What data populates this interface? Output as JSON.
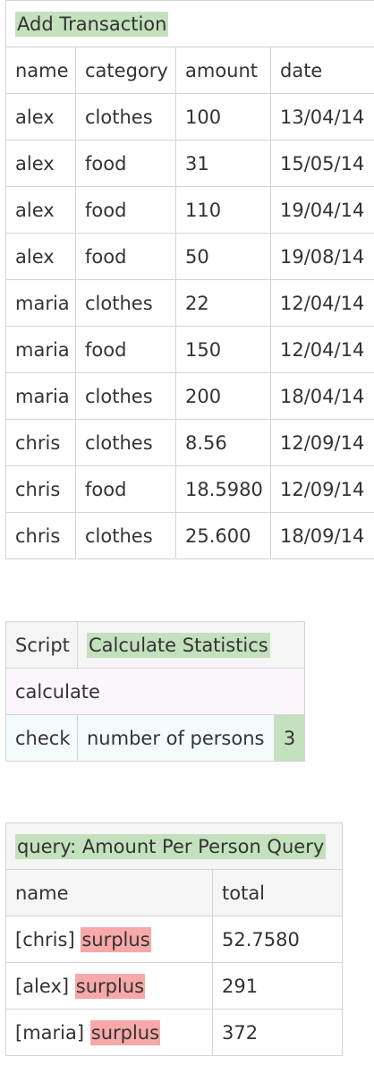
{
  "transactions": {
    "title": "Add Transaction",
    "columns": [
      "name",
      "category",
      "amount",
      "date"
    ],
    "rows": [
      [
        "alex",
        "clothes",
        "100",
        "13/04/14"
      ],
      [
        "alex",
        "food",
        "31",
        "15/05/14"
      ],
      [
        "alex",
        "food",
        "110",
        "19/04/14"
      ],
      [
        "alex",
        "food",
        "50",
        "19/08/14"
      ],
      [
        "maria",
        "clothes",
        "22",
        "12/04/14"
      ],
      [
        "maria",
        "food",
        "150",
        "12/04/14"
      ],
      [
        "maria",
        "clothes",
        "200",
        "18/04/14"
      ],
      [
        "chris",
        "clothes",
        "8.56",
        "12/09/14"
      ],
      [
        "chris",
        "food",
        "18.5980",
        "12/09/14"
      ],
      [
        "chris",
        "clothes",
        "25.600",
        "18/09/14"
      ]
    ]
  },
  "script": {
    "label": "Script",
    "name": "Calculate Statistics",
    "action": "calculate",
    "check_label": "check",
    "check_field": "number of persons",
    "check_value": "3",
    "colors": {
      "pass": "#c4e1bd"
    }
  },
  "query": {
    "title": "query: Amount Per Person Query",
    "columns": [
      "name",
      "total"
    ],
    "rows": [
      {
        "name": "[chris]",
        "flag": "surplus",
        "total": "52.7580"
      },
      {
        "name": "[alex]",
        "flag": "surplus",
        "total": "291"
      },
      {
        "name": "[maria]",
        "flag": "surplus",
        "total": "372"
      }
    ],
    "colors": {
      "surplus": "#f7a8a8"
    }
  }
}
